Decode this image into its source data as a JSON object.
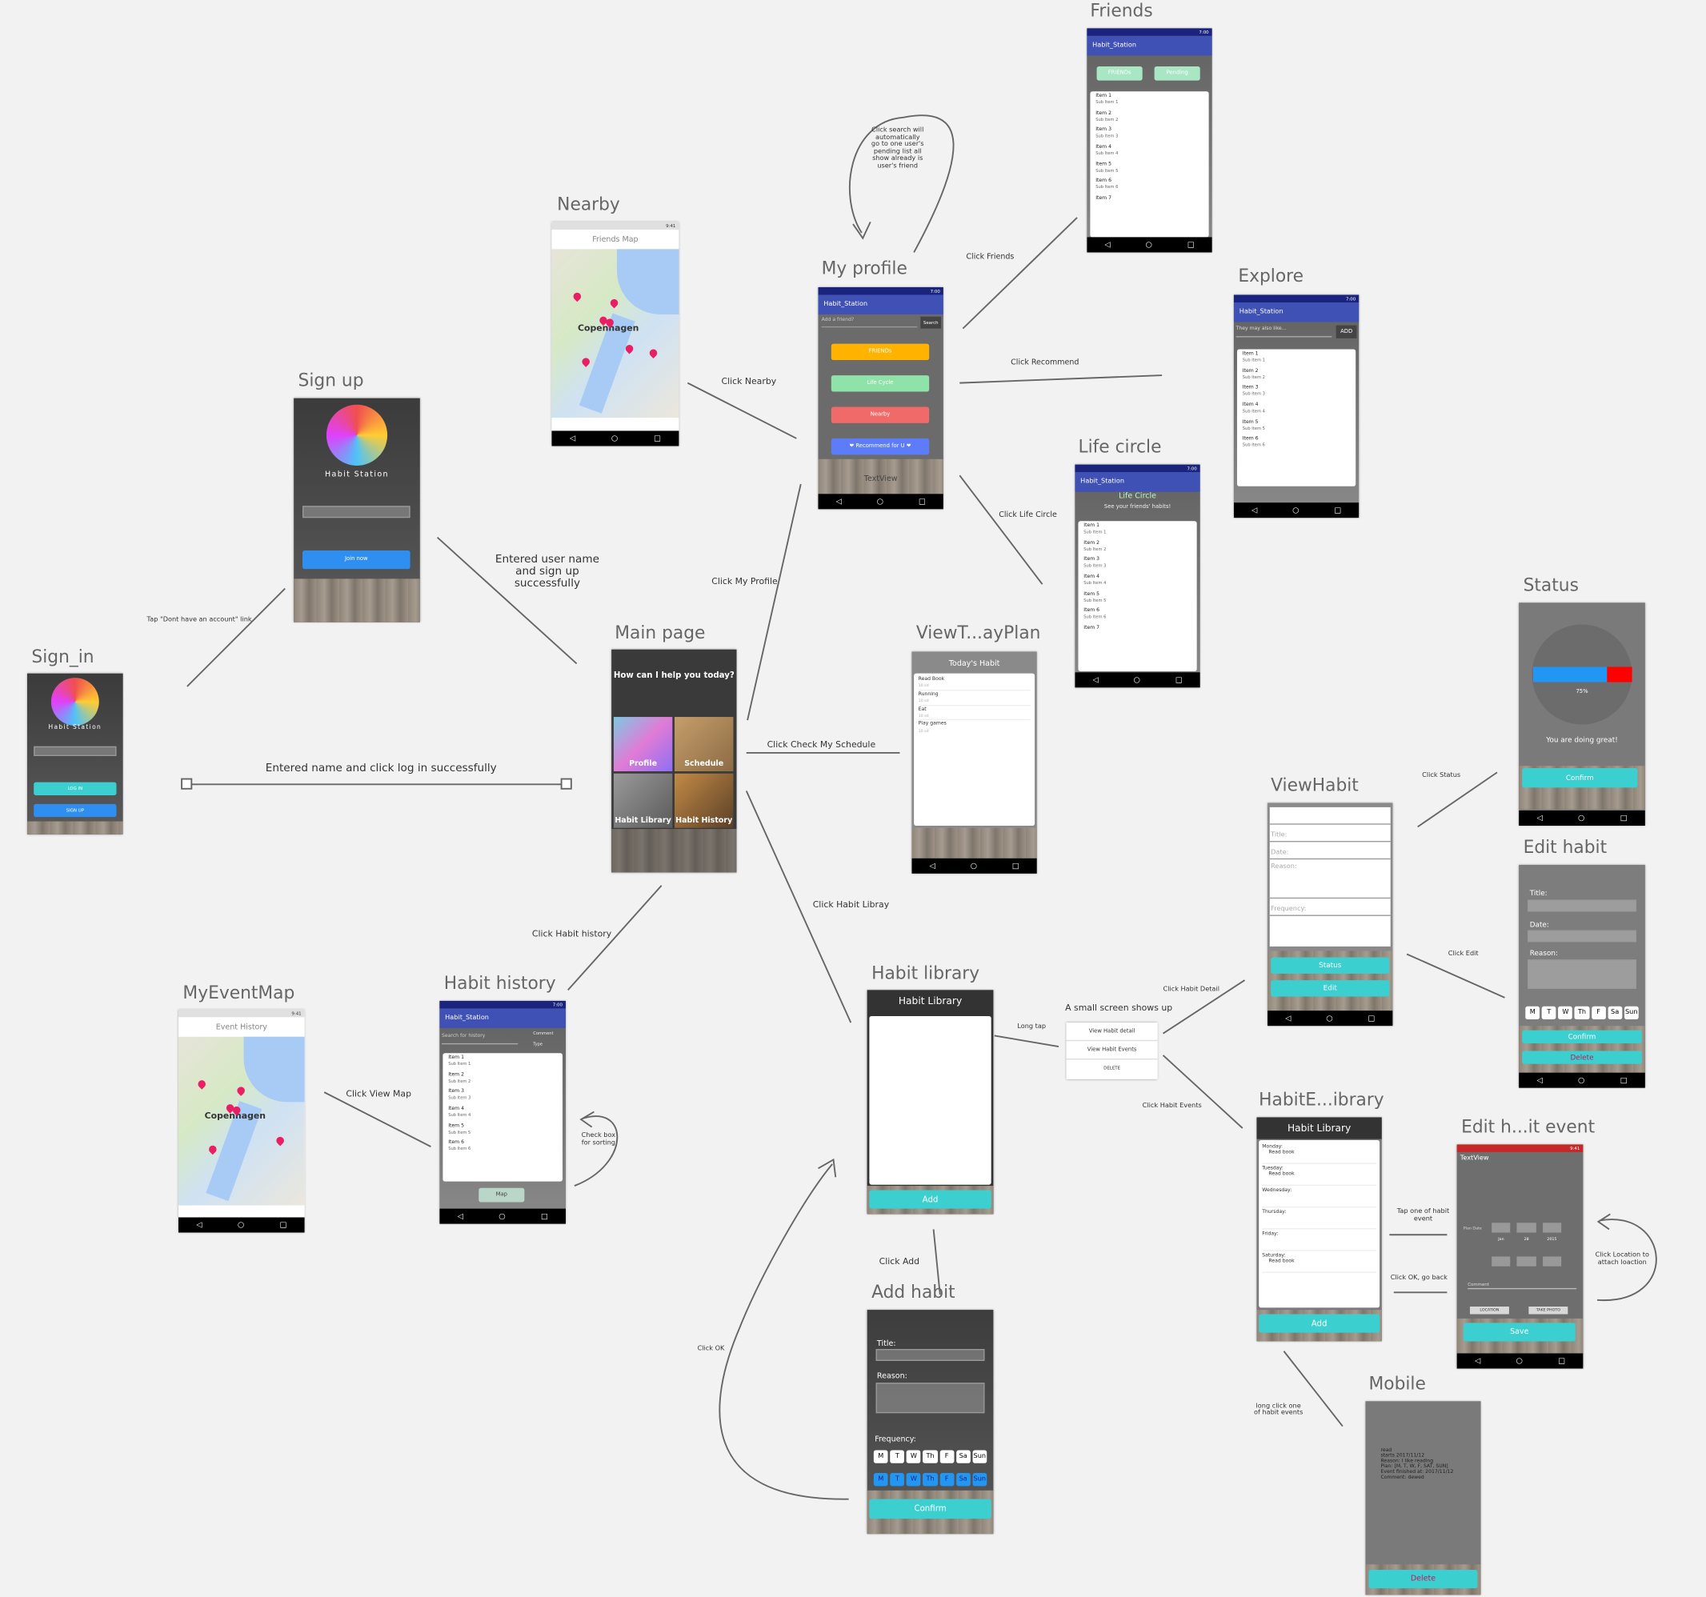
{
  "titles": {
    "friends": "Friends",
    "nearby": "Nearby",
    "my_profile": "My profile",
    "explore": "Explore",
    "sign_up": "Sign up",
    "life_circle": "Life circle",
    "sign_in": "Sign_in",
    "main_page": "Main page",
    "viewt": "ViewT...ayPlan",
    "status": "Status",
    "viewhabit": "ViewHabit",
    "edit_habit": "Edit habit",
    "myeventmap": "MyEventMap",
    "habit_history": "Habit history",
    "habit_library": "Habit library",
    "habite": "HabitE...ibrary",
    "edit_event": "Edit h...it event",
    "add_habit": "Add habit",
    "mobile": "Mobile"
  },
  "labels": {
    "click_friends": "Click Friends",
    "click_nearby": "Click Nearby",
    "click_recommend": "Click Recommend",
    "self_note": "Click search will automatically go to one user's pending list all show already is user's friend",
    "tap_dont": "Tap \"Dont have an account\" link",
    "entered_signup": "Entered user name and sign up successfully",
    "click_my_profile": "Click My Profile",
    "click_life_circle": "Click Life Circle",
    "entered_login": "Entered name and click log in successfully",
    "click_check_schedule": "Click Check My Schedule",
    "click_status": "Click Status",
    "click_habit_library": "Click Habit Libray",
    "click_habit_history": "Click Habit history",
    "click_view_map": "Click View Map",
    "check_box_sorting": "Check box for sorting",
    "long_tap": "Long tap",
    "small_screen": "A small screen shows up",
    "click_habit_detail": "Click Habit Detail",
    "click_edit": "Click Edit",
    "click_habit_events": "Click Habit Events",
    "tap_one_event": "Tap one of habit event",
    "click_ok_back": "Click OK, go back",
    "click_location": "Click Location to attach loaction",
    "click_add": "Click Add",
    "click_ok": "Click OK",
    "long_click": "long click one of habit events"
  },
  "common": {
    "app": "Habit_Station",
    "time": "7:00",
    "time2": "9:41",
    "brand": "Habit Station"
  },
  "items": [
    {
      "t": "Item 1",
      "s": "Sub Item 1"
    },
    {
      "t": "Item 2",
      "s": "Sub Item 2"
    },
    {
      "t": "Item 3",
      "s": "Sub Item 3"
    },
    {
      "t": "Item 4",
      "s": "Sub Item 4"
    },
    {
      "t": "Item 5",
      "s": "Sub Item 5"
    },
    {
      "t": "Item 6",
      "s": "Sub Item 6"
    },
    {
      "t": "Item 7",
      "s": ""
    }
  ],
  "friends": {
    "tab1": "FRIENDs",
    "tab2": "Pending"
  },
  "explore": {
    "placeholder": "They may also like...",
    "add": "ADD"
  },
  "profile": {
    "search_ph": "Add a friend?",
    "search": "Search",
    "b1": "FRIENDs",
    "b2": "Life Cycle",
    "b3": "Nearby",
    "b4": "❤ Recommend for U ❤",
    "tv": "TextView"
  },
  "life": {
    "title": "Life Circle",
    "sub": "See your friends' habits!"
  },
  "nearby": {
    "bar": "Friends Map",
    "city": "Copenhagen"
  },
  "signup": {
    "join": "Join now"
  },
  "signin": {
    "login": "LOG IN",
    "signup": "SIGN UP"
  },
  "main": {
    "q": "How can I help you today?",
    "t1": "Profile",
    "t2": "Schedule",
    "t3": "Habit Library",
    "t4": "Habit History"
  },
  "today": {
    "bar": "Today's Habit",
    "r1": "Read Book",
    "r2": "Running",
    "r3": "Eat",
    "r4": "Play games",
    "sub": "10 sd"
  },
  "status": {
    "pct": "75%",
    "msg": "You are doing great!",
    "confirm": "Confirm",
    "progress": 0.75
  },
  "viewhabit": {
    "title": "Title:",
    "date": "Date:",
    "reason": "Reason:",
    "freq": "Frequency:",
    "status": "Status",
    "edit": "Edit"
  },
  "edithabit": {
    "title": "Title:",
    "date": "Date:",
    "reason": "Reason:",
    "confirm": "Confirm",
    "delete": "Delete"
  },
  "days": [
    "M",
    "T",
    "W",
    "Th",
    "F",
    "Sa",
    "Sun"
  ],
  "eventmap": {
    "bar": "Event History",
    "city": "Copenhagen"
  },
  "history": {
    "search_ph": "Search for history",
    "c1": "Comment",
    "c2": "Type",
    "map": "Map"
  },
  "library": {
    "bar": "Habit Library",
    "add": "Add"
  },
  "popup": {
    "m1": "View Habit detail",
    "m2": "View Habit Events",
    "m3": "DELETE"
  },
  "events": {
    "bar": "Habit Library",
    "add": "Add",
    "days": [
      {
        "d": "Monday:",
        "v": "Read book"
      },
      {
        "d": "Tuesday:",
        "v": "Read book"
      },
      {
        "d": "Wednesday:",
        "v": ""
      },
      {
        "d": "Thursday:",
        "v": ""
      },
      {
        "d": "Friday:",
        "v": ""
      },
      {
        "d": "Saturday:",
        "v": "Read book"
      }
    ]
  },
  "editevent": {
    "tv": "TextView",
    "plan": "Plan Date",
    "c": "Comment",
    "loc": "LOCATION",
    "photo": "TAKE PHOTO",
    "save": "Save",
    "cols": [
      "Jan",
      "28",
      "2015"
    ]
  },
  "addhabit": {
    "title": "Title:",
    "reason": "Reason:",
    "freq": "Frequency:",
    "confirm": "Confirm"
  },
  "mobile": {
    "lines": [
      "read",
      "starts 2017/11/12",
      "Reason: I like reading",
      "Plan: [M, T, W, F, SAT, SUN]",
      "Event finished at: 2017/11/12",
      "Comment: dewed"
    ],
    "del": "Delete"
  }
}
